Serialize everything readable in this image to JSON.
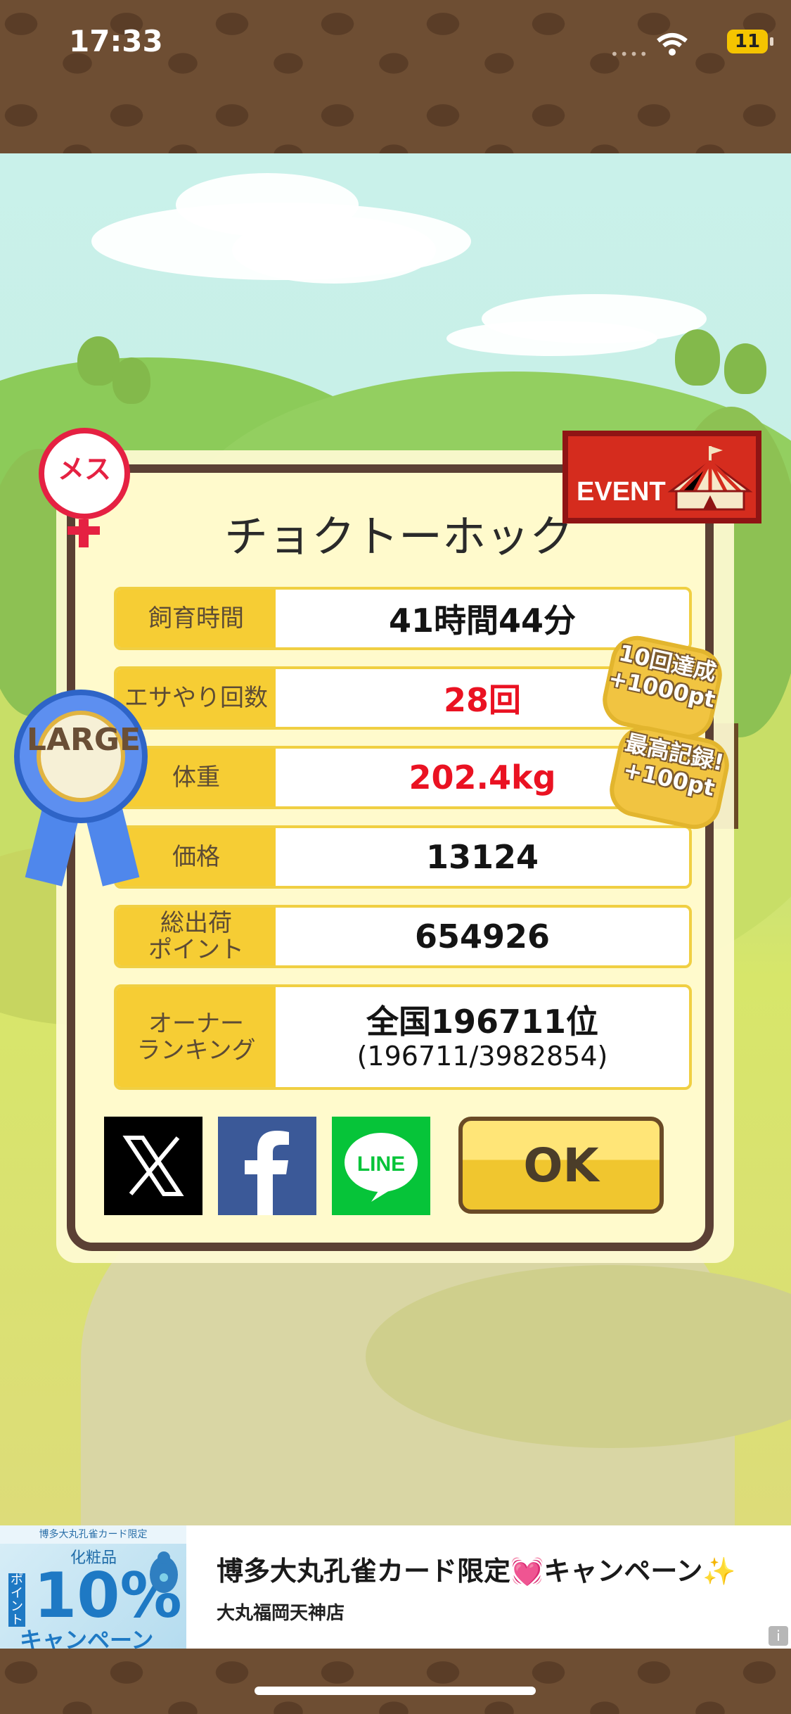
{
  "status_bar": {
    "time": "17:33",
    "battery": "11"
  },
  "card": {
    "title": "チョクトーホック",
    "rows": [
      {
        "label": "飼育時間",
        "value": "41時間44分"
      },
      {
        "label": "エサやり回数",
        "value": "28回"
      },
      {
        "label": "体重",
        "value": "202.4kg"
      },
      {
        "label": "価格",
        "value": "13124"
      },
      {
        "label": "総出荷\nポイント",
        "value": "654926"
      },
      {
        "label": "オーナー\nランキング",
        "value": "全国196711位",
        "sub": "(196711/3982854)"
      }
    ],
    "ok_label": "OK",
    "share": {
      "line_label": "LINE"
    }
  },
  "badges": {
    "gender": "メス",
    "event": "EVENT",
    "size": "LARGE",
    "achievement_1": "10回達成\n+1000pt",
    "achievement_2": "最高記録!\n+100pt"
  },
  "ad": {
    "image_top": "博多大丸孔雀カード限定",
    "image_sub": "化粧品",
    "image_big": "10%",
    "image_campaign": "キャンペーン",
    "image_point": "ポイント",
    "title": "博多大丸孔雀カード限定💓キャンペーン✨",
    "store": "大丸福岡天神店",
    "info": "i"
  },
  "colors": {
    "accent_yellow": "#f6cd34",
    "highlight_red": "#ea1222",
    "frame_brown": "#5b4034"
  }
}
